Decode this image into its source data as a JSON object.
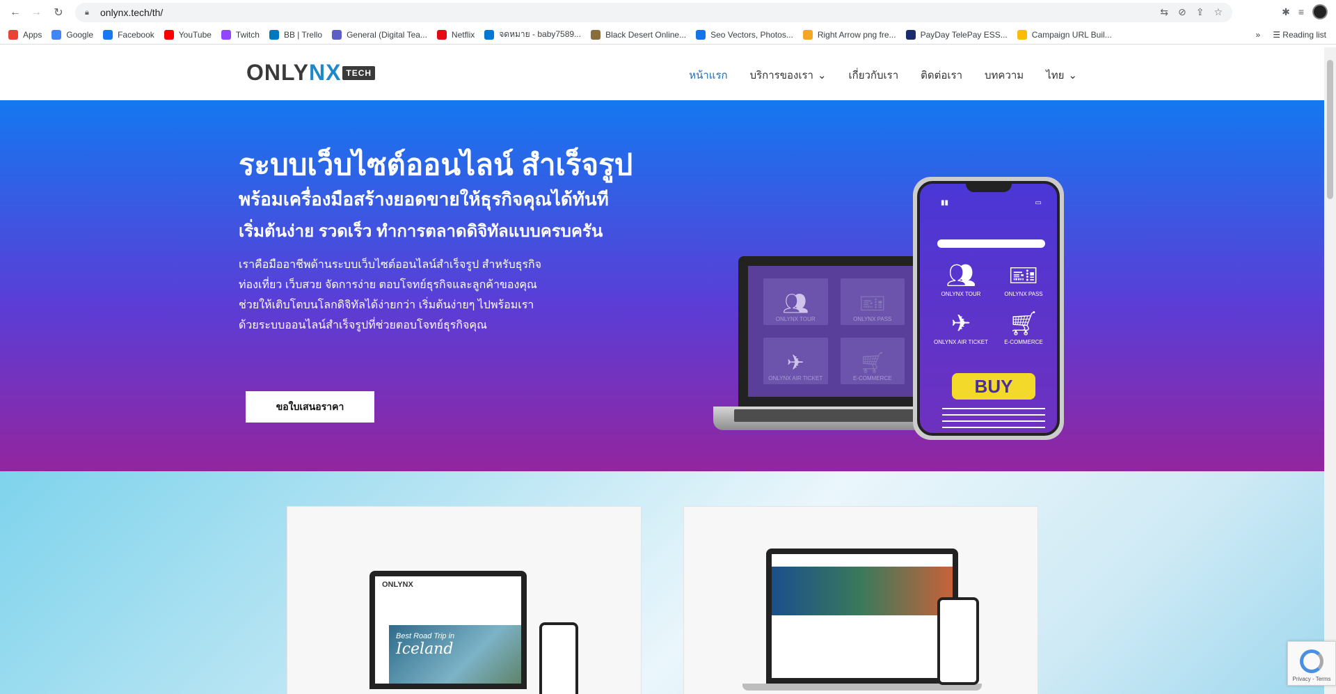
{
  "browser": {
    "url": "onlynx.tech/th/",
    "bookmarks": [
      {
        "label": "Apps",
        "icon": "apps-grid-icon",
        "color": "#ea4335"
      },
      {
        "label": "Google",
        "icon": "google-icon",
        "color": "#4285f4"
      },
      {
        "label": "Facebook",
        "icon": "facebook-icon",
        "color": "#1877f2"
      },
      {
        "label": "YouTube",
        "icon": "youtube-icon",
        "color": "#ff0000"
      },
      {
        "label": "Twitch",
        "icon": "twitch-icon",
        "color": "#9146ff"
      },
      {
        "label": "BB | Trello",
        "icon": "trello-icon",
        "color": "#0079bf"
      },
      {
        "label": "General (Digital Tea...",
        "icon": "teams-icon",
        "color": "#5b5fc7"
      },
      {
        "label": "Netflix",
        "icon": "netflix-icon",
        "color": "#e50914"
      },
      {
        "label": "จดหมาย - baby7589...",
        "icon": "outlook-icon",
        "color": "#0078d4"
      },
      {
        "label": "Black Desert Online...",
        "icon": "bdo-icon",
        "color": "#8a6d3b"
      },
      {
        "label": "Seo Vectors, Photos...",
        "icon": "freepik-icon",
        "color": "#1273eb"
      },
      {
        "label": "Right Arrow png fre...",
        "icon": "pngtree-icon",
        "color": "#f5a623"
      },
      {
        "label": "PayDay TelePay ESS...",
        "icon": "payday-icon",
        "color": "#1a2b6d"
      },
      {
        "label": "Campaign URL Buil...",
        "icon": "chrome-icon",
        "color": "#fbbc05"
      }
    ],
    "reading_list": "Reading list"
  },
  "site": {
    "logo_a": "ONLY",
    "logo_b": "NX",
    "logo_tech": "TECH",
    "nav": {
      "home": "หน้าแรก",
      "services": "บริการของเรา",
      "about": "เกี่ยวกับเรา",
      "contact": "ติดต่อเรา",
      "articles": "บทความ",
      "language": "ไทย"
    }
  },
  "hero": {
    "title": "ระบบเว็บไซต์ออนไลน์ สำเร็จรูป",
    "subtitle": "พร้อมเครื่องมือสร้างยอดขายให้ธุรกิจคุณได้ทันที",
    "tagline": "เริ่มต้นง่าย รวดเร็ว ทำการตลาดดิจิทัลแบบครบครัน",
    "description": "เราคือมืออาชีพด้านระบบเว็บไซต์ออนไลน์สำเร็จรูป สำหรับธุรกิจท่องเที่ยว เว็บสวย จัดการง่าย ตอบโจทย์ธุรกิจและลูกค้าของคุณ ช่วยให้เติบโตบนโลกดิจิทัลได้ง่ายกว่า เริ่มต้นง่ายๆ ไปพร้อมเรา ด้วยระบบออนไลน์สำเร็จรูปที่ช่วยตอบโจทย์ธุรกิจคุณ",
    "cta": "ขอใบเสนอราคา",
    "laptop_tiles": [
      "ONLYNX TOUR",
      "ONLYNX PASS",
      "ONLYNX AIR TICKET",
      "E-COMMERCE"
    ],
    "phone_tiles": [
      "ONLYNX TOUR",
      "ONLYNX PASS",
      "ONLYNX AIR TICKET",
      "E-COMMERCE"
    ],
    "buy": "BUY"
  },
  "cards": {
    "card1_logo": "ONLYNX",
    "card1_image_text_a": "Best Road Trip in",
    "card1_image_text_b": "Iceland"
  },
  "recaptcha": {
    "label": "Privacy - Terms"
  },
  "colors": {
    "hero_top": "#1478f0",
    "hero_bottom": "#93259f",
    "nav_active": "#1e6fb8",
    "buy": "#f2d92a"
  }
}
